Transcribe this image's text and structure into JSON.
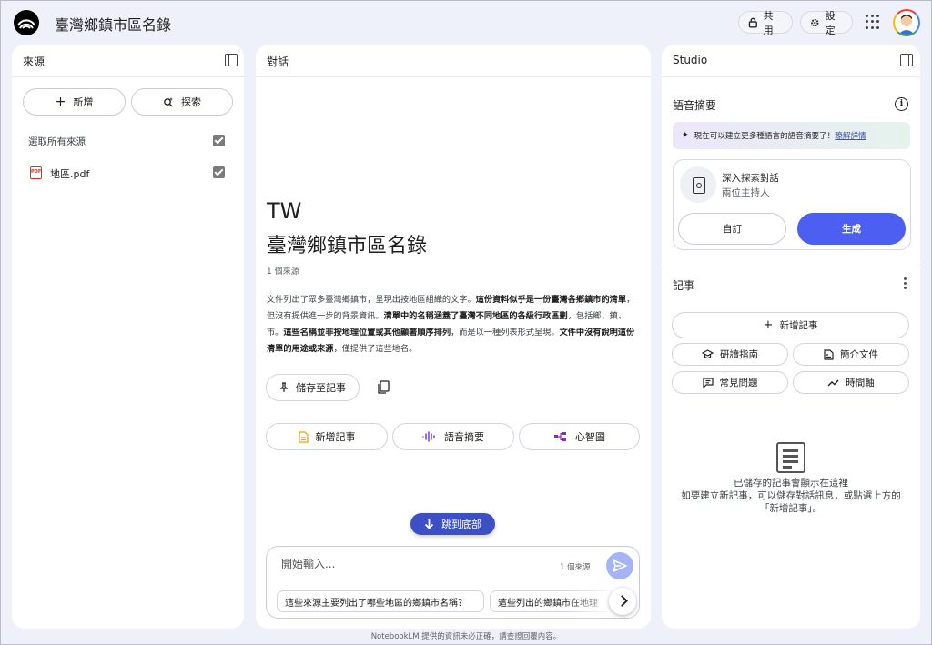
{
  "header": {
    "title": "臺灣鄉鎮市區名錄",
    "share_label": "共用",
    "settings_label": "設定"
  },
  "sources": {
    "title": "來源",
    "add_label": "新增",
    "discover_label": "探索",
    "select_all_label": "選取所有來源",
    "items": [
      {
        "name": "地區.pdf",
        "icon": "PDF"
      }
    ]
  },
  "chat": {
    "title": "對話",
    "heading_line1": "TW",
    "heading_line2": "臺灣鄉鎮市區名錄",
    "source_count": "1 個來源",
    "summary": [
      {
        "text": "文件列出了眾多臺灣鄉鎮市，呈現出按地區組織的文字。",
        "bold": false
      },
      {
        "text": "這份資料似乎是一份臺灣各鄉鎮市的清單",
        "bold": true
      },
      {
        "text": "，但沒有提供進一步的背景資訊。",
        "bold": false
      },
      {
        "text": "清單中的名稱涵蓋了臺灣不同地區的各級行政區劃",
        "bold": true
      },
      {
        "text": "，包括鄉、鎮、市。",
        "bold": false
      },
      {
        "text": "這些名稱並非按地理位置或其他顯著順序排列",
        "bold": true
      },
      {
        "text": "，而是以一種列表形式呈現。",
        "bold": false
      },
      {
        "text": "文件中沒有說明這份清單的用途或來源",
        "bold": true
      },
      {
        "text": "，僅提供了這些地名。",
        "bold": false
      }
    ],
    "save_note_label": "儲存至記事",
    "action_add_note": "新增記事",
    "action_audio": "語音摘要",
    "action_mindmap": "心智圖",
    "jump_label": "跳到底部",
    "input_placeholder": "開始輸入...",
    "input_source_count": "1 個來源",
    "suggestions": [
      "這些來源主要列出了哪些地區的鄉鎮市名稱？",
      "這些列出的鄉鎮市在地理"
    ]
  },
  "studio": {
    "title": "Studio",
    "audio_section": "語音摘要",
    "notice_text": "現在可以建立更多種語言的語音摘要了！",
    "notice_link": "瞭解詳情",
    "audio_card_title": "深入探索對話",
    "audio_card_sub": "兩位主持人",
    "customize_label": "自訂",
    "generate_label": "生成",
    "notes_section": "記事",
    "add_note_label": "新增記事",
    "study_guide_label": "研讀指南",
    "briefing_label": "簡介文件",
    "faq_label": "常見問題",
    "timeline_label": "時間軸",
    "empty_line1": "已儲存的記事會顯示在這裡",
    "empty_line2": "如要建立新記事，可以儲存對話訊息，或點選上方的",
    "empty_line3": "「新增記事」。"
  },
  "footer": {
    "note": "NotebookLM 提供的資訊未必正確，請查證回覆內容。"
  },
  "colors": {
    "accent": "#4c5ff0",
    "jump_button": "#3d4fc4",
    "send_button": "#a5b4f6",
    "background": "#eef0fa",
    "pdf_red": "#d93025",
    "doc_yellow": "#f2a600",
    "audio_purple": "#7b4ce0",
    "mindmap_purple": "#8a2bbf"
  }
}
